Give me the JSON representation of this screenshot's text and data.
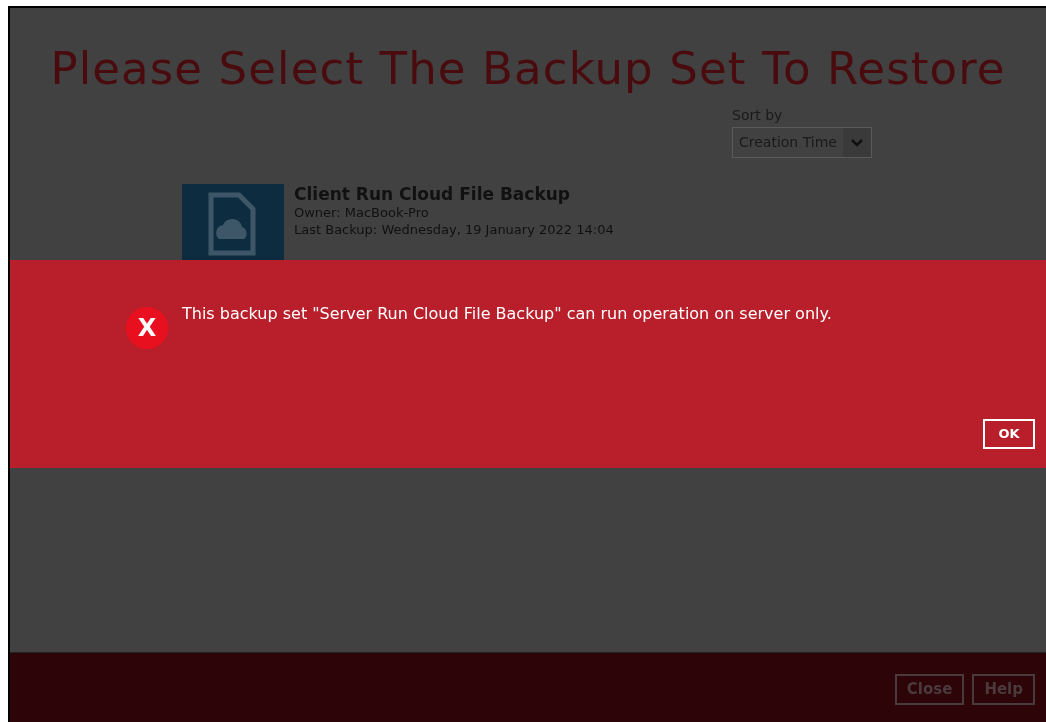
{
  "page": {
    "title": "Please Select The Backup Set To Restore"
  },
  "sort": {
    "label": "Sort by",
    "value": "Creation Time"
  },
  "backup_sets": [
    {
      "name": "Client Run Cloud File Backup",
      "owner": "Owner: MacBook-Pro",
      "last_backup": "Last Backup: Wednesday, 19 January 2022 14:04"
    }
  ],
  "alert": {
    "icon": "X",
    "message": "This backup set \"Server Run Cloud File Backup\" can run operation on server only.",
    "button": "OK"
  },
  "footer": {
    "buttons": [
      "Close",
      "Help"
    ]
  }
}
